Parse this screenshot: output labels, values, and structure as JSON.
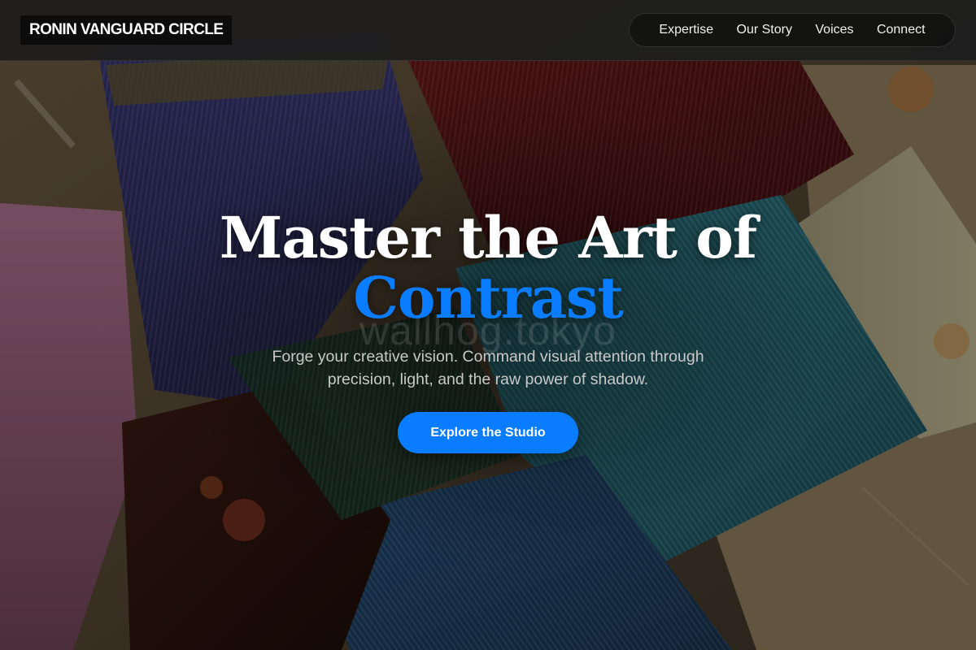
{
  "header": {
    "logo_text": "RONIN VANGUARD CIRCLE",
    "nav": [
      {
        "label": "Expertise"
      },
      {
        "label": "Our Story"
      },
      {
        "label": "Voices"
      },
      {
        "label": "Connect"
      }
    ]
  },
  "hero": {
    "headline_line1": "Master the Art of",
    "headline_accent": "Contrast",
    "watermark": "wallhog.tokyo",
    "subtitle": "Forge your creative vision. Command visual attention through precision, light, and the raw power of shadow.",
    "cta_label": "Explore the Studio"
  },
  "colors": {
    "accent": "#0a7cff",
    "header_bg": "#1e1e1e",
    "text": "#ffffff",
    "subtitle_text": "#c9c9c9"
  }
}
